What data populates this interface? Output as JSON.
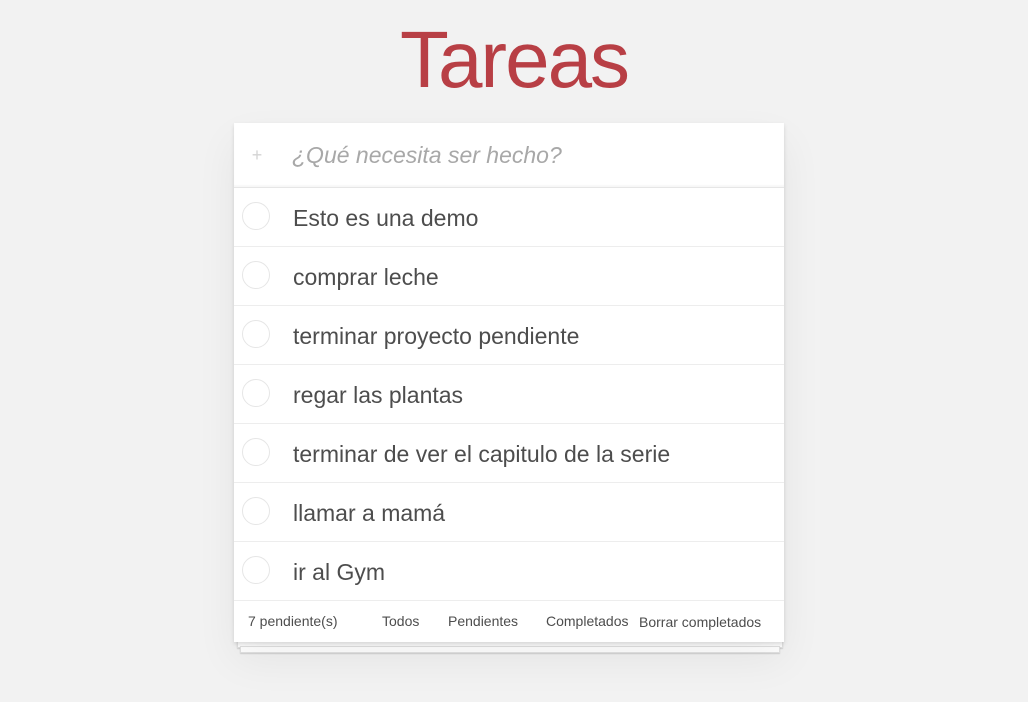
{
  "app": {
    "title": "Tareas",
    "accent_color": "#b83f45"
  },
  "new_todo": {
    "icon": "plus-icon",
    "placeholder": "¿Qué necesita ser hecho?",
    "value": ""
  },
  "todos": [
    {
      "label": "Esto es una demo",
      "completed": false
    },
    {
      "label": "comprar leche",
      "completed": false
    },
    {
      "label": "terminar proyecto pendiente",
      "completed": false
    },
    {
      "label": "regar las plantas",
      "completed": false
    },
    {
      "label": "terminar de ver el capitulo de la serie",
      "completed": false
    },
    {
      "label": "llamar a mamá",
      "completed": false
    },
    {
      "label": "ir al Gym",
      "completed": false
    }
  ],
  "footer": {
    "count": "7 pendiente(s)",
    "filters": {
      "all": "Todos",
      "active": "Pendientes",
      "completed": "Completados"
    },
    "clear_completed": "Borrar completados"
  }
}
